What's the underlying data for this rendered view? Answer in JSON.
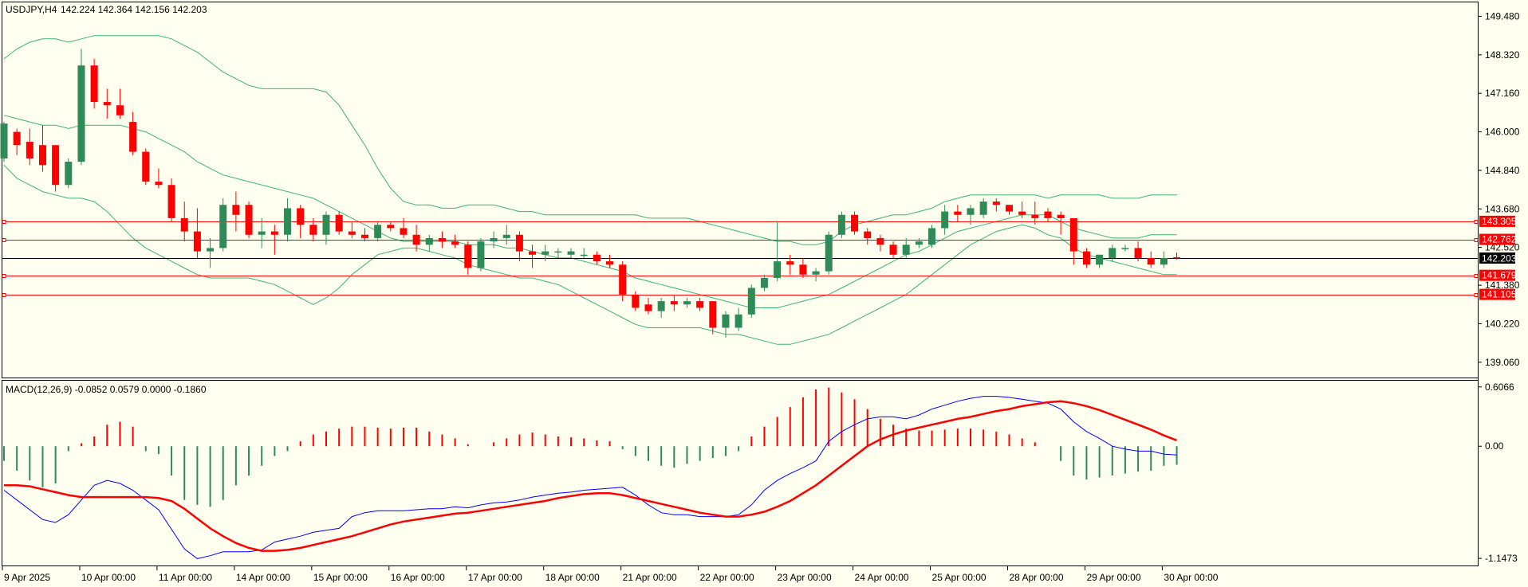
{
  "header": {
    "symbol": "USDJPY,H4",
    "ohlc": "142.224 142.364 142.156 142.203"
  },
  "macd_header": {
    "title": "MACD(12,26,9) -0.0852 0.0579 0.0000 -0.1860"
  },
  "colors": {
    "background": "#fffff0",
    "bull": "#2e8b57",
    "bear": "#ff0000",
    "band": "#3cb371",
    "level_line": "#ff0000",
    "macd_line": "#0000ff",
    "signal_line": "#ff0000"
  },
  "chart_data": [
    {
      "type": "candlestick",
      "ylim": [
        138.6,
        149.9
      ],
      "price_ticks": [
        "149.480",
        "148.320",
        "147.160",
        "146.000",
        "144.840",
        "143.680",
        "142.520",
        "141.380",
        "140.220",
        "139.060"
      ],
      "x_labels": [
        "9 Apr 2025",
        "10 Apr 00:00",
        "11 Apr 00:00",
        "14 Apr 00:00",
        "15 Apr 00:00",
        "16 Apr 00:00",
        "17 Apr 00:00",
        "18 Apr 00:00",
        "21 Apr 00:00",
        "22 Apr 00:00",
        "23 Apr 00:00",
        "24 Apr 00:00",
        "25 Apr 00:00",
        "28 Apr 00:00",
        "29 Apr 00:00",
        "30 Apr 00:00"
      ],
      "x_label_index": [
        0,
        6,
        12,
        18,
        24,
        30,
        36,
        42,
        48,
        54,
        60,
        66,
        72,
        78,
        84,
        90
      ],
      "level_lines": [
        {
          "value": 143.305,
          "label": "143.305"
        },
        {
          "value": 142.762,
          "label": "142.762"
        },
        {
          "value": 141.679,
          "label": "141.679"
        },
        {
          "value": 141.105,
          "label": "141.105"
        }
      ],
      "current_price": {
        "value": 142.203,
        "label": "142.203"
      },
      "candles": [
        [
          145.2,
          146.3,
          145.1,
          146.25
        ],
        [
          146.0,
          146.1,
          145.3,
          145.6
        ],
        [
          145.7,
          146.1,
          145.0,
          145.2
        ],
        [
          145.6,
          146.2,
          144.8,
          145.0
        ],
        [
          145.6,
          145.6,
          144.2,
          144.4
        ],
        [
          144.4,
          145.2,
          144.3,
          145.1
        ],
        [
          145.1,
          148.5,
          145.0,
          148.0
        ],
        [
          148.0,
          148.2,
          146.7,
          146.9
        ],
        [
          146.9,
          147.3,
          146.4,
          146.8
        ],
        [
          146.8,
          147.3,
          146.4,
          146.5
        ],
        [
          146.3,
          146.6,
          145.3,
          145.4
        ],
        [
          145.4,
          145.5,
          144.4,
          144.5
        ],
        [
          144.5,
          144.9,
          144.3,
          144.4
        ],
        [
          144.4,
          144.6,
          143.3,
          143.4
        ],
        [
          143.4,
          143.9,
          142.7,
          143.0
        ],
        [
          143.0,
          143.7,
          142.2,
          142.4
        ],
        [
          142.4,
          142.8,
          141.9,
          142.5
        ],
        [
          142.5,
          144.0,
          142.4,
          143.8
        ],
        [
          143.8,
          144.2,
          143.0,
          143.5
        ],
        [
          143.8,
          143.9,
          142.8,
          142.9
        ],
        [
          142.9,
          143.4,
          142.5,
          143.0
        ],
        [
          143.0,
          143.2,
          142.3,
          142.9
        ],
        [
          142.9,
          144.0,
          142.7,
          143.7
        ],
        [
          143.7,
          143.8,
          142.8,
          143.2
        ],
        [
          143.2,
          143.4,
          142.7,
          142.9
        ],
        [
          142.9,
          143.6,
          142.6,
          143.5
        ],
        [
          143.5,
          143.6,
          142.9,
          143.0
        ],
        [
          143.0,
          143.3,
          142.8,
          142.9
        ],
        [
          142.9,
          143.1,
          142.7,
          142.8
        ],
        [
          142.8,
          143.3,
          142.7,
          143.2
        ],
        [
          143.2,
          143.3,
          143.0,
          143.1
        ],
        [
          143.1,
          143.4,
          142.8,
          142.9
        ],
        [
          142.9,
          143.2,
          142.4,
          142.6
        ],
        [
          142.6,
          142.9,
          142.4,
          142.8
        ],
        [
          142.8,
          143.0,
          142.5,
          142.7
        ],
        [
          142.7,
          142.9,
          142.5,
          142.6
        ],
        [
          142.6,
          142.7,
          141.7,
          141.9
        ],
        [
          141.9,
          142.8,
          141.8,
          142.7
        ],
        [
          142.7,
          143.0,
          142.5,
          142.8
        ],
        [
          142.8,
          143.2,
          142.6,
          142.9
        ],
        [
          142.9,
          143.0,
          142.1,
          142.4
        ],
        [
          142.4,
          142.6,
          141.9,
          142.3
        ],
        [
          142.3,
          142.6,
          142.1,
          142.4
        ],
        [
          142.4,
          142.5,
          142.2,
          142.4
        ],
        [
          142.3,
          142.5,
          142.2,
          142.4
        ],
        [
          142.3,
          142.5,
          142.2,
          142.3
        ],
        [
          142.3,
          142.4,
          142.0,
          142.1
        ],
        [
          142.1,
          142.3,
          141.9,
          142.0
        ],
        [
          142.0,
          142.1,
          140.9,
          141.1
        ],
        [
          141.1,
          141.2,
          140.6,
          140.7
        ],
        [
          140.8,
          141.0,
          140.5,
          140.6
        ],
        [
          140.6,
          141.0,
          140.4,
          140.9
        ],
        [
          140.9,
          141.1,
          140.6,
          140.8
        ],
        [
          140.8,
          141.0,
          140.7,
          140.9
        ],
        [
          140.9,
          141.0,
          140.6,
          140.7
        ],
        [
          140.9,
          140.9,
          139.9,
          140.1
        ],
        [
          140.1,
          140.6,
          139.8,
          140.5
        ],
        [
          140.1,
          140.7,
          140.0,
          140.5
        ],
        [
          140.5,
          141.4,
          140.4,
          141.3
        ],
        [
          141.3,
          141.7,
          141.2,
          141.6
        ],
        [
          141.6,
          143.3,
          141.5,
          142.1
        ],
        [
          142.1,
          142.3,
          141.7,
          142.0
        ],
        [
          142.0,
          142.2,
          141.6,
          141.7
        ],
        [
          141.7,
          141.9,
          141.5,
          141.8
        ],
        [
          141.8,
          143.0,
          141.7,
          142.9
        ],
        [
          142.9,
          143.6,
          142.8,
          143.5
        ],
        [
          143.5,
          143.6,
          142.9,
          143.0
        ],
        [
          143.0,
          143.1,
          142.6,
          142.8
        ],
        [
          142.8,
          142.9,
          142.4,
          142.6
        ],
        [
          142.6,
          142.7,
          142.2,
          142.3
        ],
        [
          142.3,
          142.8,
          142.2,
          142.6
        ],
        [
          142.6,
          142.8,
          142.5,
          142.7
        ],
        [
          142.6,
          143.2,
          142.5,
          143.1
        ],
        [
          143.1,
          143.8,
          142.9,
          143.6
        ],
        [
          143.6,
          143.8,
          143.3,
          143.5
        ],
        [
          143.5,
          143.8,
          143.2,
          143.7
        ],
        [
          143.5,
          144.0,
          143.4,
          143.9
        ],
        [
          143.9,
          144.0,
          143.6,
          143.8
        ],
        [
          143.8,
          143.8,
          143.5,
          143.6
        ],
        [
          143.6,
          143.9,
          143.4,
          143.5
        ],
        [
          143.5,
          143.9,
          143.2,
          143.4
        ],
        [
          143.6,
          143.7,
          143.3,
          143.4
        ],
        [
          143.5,
          143.6,
          142.9,
          143.4
        ],
        [
          143.4,
          143.4,
          142.0,
          142.4
        ],
        [
          142.4,
          142.5,
          141.9,
          142.0
        ],
        [
          142.0,
          142.3,
          141.9,
          142.3
        ],
        [
          142.2,
          142.6,
          142.1,
          142.5
        ],
        [
          142.5,
          142.6,
          142.4,
          142.5
        ],
        [
          142.5,
          142.7,
          142.1,
          142.2
        ],
        [
          142.2,
          142.4,
          141.9,
          142.0
        ],
        [
          142.0,
          142.4,
          141.9,
          142.2
        ],
        [
          142.224,
          142.364,
          142.156,
          142.203
        ]
      ],
      "bollinger": {
        "upper": [
          148.2,
          148.5,
          148.7,
          148.8,
          148.8,
          148.7,
          148.8,
          148.9,
          148.9,
          148.9,
          148.9,
          148.9,
          148.9,
          148.8,
          148.6,
          148.4,
          148.1,
          147.8,
          147.6,
          147.4,
          147.3,
          147.3,
          147.3,
          147.3,
          147.3,
          147.2,
          146.8,
          146.2,
          145.6,
          144.9,
          144.3,
          143.9,
          143.8,
          143.8,
          143.7,
          143.7,
          143.8,
          143.8,
          143.8,
          143.7,
          143.6,
          143.6,
          143.5,
          143.5,
          143.5,
          143.5,
          143.5,
          143.5,
          143.5,
          143.5,
          143.4,
          143.4,
          143.4,
          143.4,
          143.3,
          143.2,
          143.1,
          143.0,
          142.9,
          142.8,
          142.7,
          142.7,
          142.6,
          142.6,
          142.7,
          143.0,
          143.2,
          143.3,
          143.4,
          143.5,
          143.5,
          143.6,
          143.7,
          143.9,
          144.0,
          144.1,
          144.1,
          144.1,
          144.1,
          144.1,
          144.1,
          144.0,
          144.1,
          144.1,
          144.1,
          144.1,
          144.0,
          144.0,
          144.0,
          144.1,
          144.1,
          144.1
        ],
        "middle": [
          146.5,
          146.4,
          146.3,
          146.2,
          146.2,
          146.1,
          146.2,
          146.2,
          146.2,
          146.2,
          146.1,
          146.0,
          145.8,
          145.6,
          145.4,
          145.1,
          144.9,
          144.7,
          144.6,
          144.5,
          144.4,
          144.3,
          144.2,
          144.1,
          144.0,
          143.8,
          143.6,
          143.4,
          143.2,
          143.0,
          142.8,
          142.7,
          142.7,
          142.7,
          142.7,
          142.7,
          142.6,
          142.6,
          142.6,
          142.5,
          142.5,
          142.4,
          142.3,
          142.2,
          142.2,
          142.1,
          142.0,
          141.9,
          141.8,
          141.6,
          141.5,
          141.4,
          141.3,
          141.2,
          141.1,
          141.0,
          140.9,
          140.8,
          140.7,
          140.7,
          140.7,
          140.8,
          140.9,
          141.0,
          141.1,
          141.3,
          141.5,
          141.7,
          141.9,
          142.1,
          142.3,
          142.4,
          142.6,
          142.8,
          143.0,
          143.1,
          143.2,
          143.3,
          143.4,
          143.5,
          143.5,
          143.5,
          143.3,
          143.1,
          143.0,
          142.9,
          142.8,
          142.8,
          142.8,
          142.9,
          142.9,
          142.9
        ],
        "lower": [
          145.0,
          144.6,
          144.4,
          144.2,
          144.1,
          144.0,
          144.0,
          143.9,
          143.6,
          143.2,
          142.8,
          142.5,
          142.3,
          142.1,
          141.9,
          141.7,
          141.6,
          141.6,
          141.6,
          141.6,
          141.5,
          141.4,
          141.2,
          141.0,
          140.8,
          141.0,
          141.3,
          141.7,
          142.0,
          142.3,
          142.4,
          142.5,
          142.5,
          142.4,
          142.3,
          142.2,
          142.0,
          141.9,
          141.8,
          141.7,
          141.6,
          141.6,
          141.5,
          141.4,
          141.2,
          141.0,
          140.8,
          140.6,
          140.4,
          140.2,
          140.1,
          140.1,
          140.1,
          140.1,
          140.1,
          140.0,
          139.9,
          139.9,
          139.8,
          139.7,
          139.6,
          139.6,
          139.7,
          139.8,
          139.9,
          140.1,
          140.3,
          140.5,
          140.7,
          140.9,
          141.1,
          141.4,
          141.7,
          142.0,
          142.3,
          142.6,
          142.8,
          143.0,
          143.1,
          143.2,
          143.1,
          142.9,
          142.8,
          142.5,
          142.3,
          142.2,
          142.1,
          142.0,
          141.9,
          141.8,
          141.7,
          141.7
        ]
      }
    },
    {
      "type": "histogram",
      "ylim": [
        -1.22,
        0.67
      ],
      "y_ticks": [
        "0.6066",
        "0.00",
        "-1.1473"
      ],
      "histogram": [
        -0.15,
        -0.25,
        -0.35,
        -0.42,
        -0.38,
        -0.05,
        0.03,
        0.1,
        0.22,
        0.25,
        0.2,
        -0.05,
        -0.08,
        -0.3,
        -0.55,
        -0.6,
        -0.62,
        -0.55,
        -0.4,
        -0.3,
        -0.2,
        -0.1,
        -0.05,
        0.05,
        0.12,
        0.15,
        0.18,
        0.2,
        0.2,
        0.19,
        0.18,
        0.19,
        0.19,
        0.15,
        0.12,
        0.08,
        0.02,
        0.0,
        0.04,
        0.08,
        0.12,
        0.14,
        0.12,
        0.1,
        0.09,
        0.08,
        0.06,
        0.05,
        -0.03,
        -0.1,
        -0.15,
        -0.2,
        -0.22,
        -0.18,
        -0.15,
        -0.12,
        -0.1,
        -0.05,
        0.1,
        0.2,
        0.3,
        0.4,
        0.5,
        0.58,
        0.6,
        0.55,
        0.48,
        0.38,
        0.28,
        0.22,
        0.18,
        0.16,
        0.16,
        0.17,
        0.18,
        0.18,
        0.17,
        0.15,
        0.12,
        0.08,
        0.04,
        0.0,
        -0.15,
        -0.3,
        -0.34,
        -0.32,
        -0.3,
        -0.28,
        -0.26,
        -0.25,
        -0.2,
        -0.19
      ],
      "macd": [
        -0.45,
        -0.55,
        -0.65,
        -0.75,
        -0.78,
        -0.7,
        -0.55,
        -0.4,
        -0.35,
        -0.38,
        -0.45,
        -0.55,
        -0.65,
        -0.85,
        -1.05,
        -1.15,
        -1.12,
        -1.08,
        -1.08,
        -1.08,
        -1.06,
        -0.98,
        -0.95,
        -0.92,
        -0.88,
        -0.86,
        -0.84,
        -0.72,
        -0.68,
        -0.66,
        -0.66,
        -0.66,
        -0.65,
        -0.64,
        -0.64,
        -0.62,
        -0.63,
        -0.6,
        -0.58,
        -0.57,
        -0.55,
        -0.52,
        -0.5,
        -0.48,
        -0.47,
        -0.45,
        -0.44,
        -0.43,
        -0.42,
        -0.5,
        -0.6,
        -0.68,
        -0.7,
        -0.7,
        -0.72,
        -0.72,
        -0.72,
        -0.7,
        -0.6,
        -0.45,
        -0.35,
        -0.28,
        -0.22,
        -0.15,
        0.05,
        0.15,
        0.22,
        0.28,
        0.3,
        0.3,
        0.28,
        0.32,
        0.38,
        0.42,
        0.46,
        0.49,
        0.51,
        0.51,
        0.5,
        0.48,
        0.46,
        0.44,
        0.38,
        0.25,
        0.15,
        0.08,
        0.0,
        -0.03,
        -0.05,
        -0.05,
        -0.08,
        -0.09
      ],
      "signal": [
        -0.4,
        -0.4,
        -0.41,
        -0.44,
        -0.47,
        -0.5,
        -0.52,
        -0.52,
        -0.52,
        -0.52,
        -0.52,
        -0.52,
        -0.53,
        -0.56,
        -0.64,
        -0.74,
        -0.84,
        -0.92,
        -0.99,
        -1.04,
        -1.07,
        -1.07,
        -1.06,
        -1.04,
        -1.01,
        -0.98,
        -0.95,
        -0.92,
        -0.88,
        -0.84,
        -0.8,
        -0.77,
        -0.75,
        -0.73,
        -0.71,
        -0.69,
        -0.68,
        -0.66,
        -0.64,
        -0.62,
        -0.6,
        -0.58,
        -0.56,
        -0.53,
        -0.51,
        -0.49,
        -0.48,
        -0.48,
        -0.5,
        -0.53,
        -0.56,
        -0.59,
        -0.62,
        -0.65,
        -0.68,
        -0.7,
        -0.72,
        -0.72,
        -0.7,
        -0.67,
        -0.62,
        -0.56,
        -0.48,
        -0.4,
        -0.3,
        -0.2,
        -0.1,
        0.0,
        0.07,
        0.12,
        0.16,
        0.19,
        0.22,
        0.25,
        0.28,
        0.3,
        0.33,
        0.36,
        0.38,
        0.41,
        0.43,
        0.45,
        0.46,
        0.44,
        0.41,
        0.37,
        0.32,
        0.27,
        0.22,
        0.17,
        0.11,
        0.06
      ]
    }
  ]
}
